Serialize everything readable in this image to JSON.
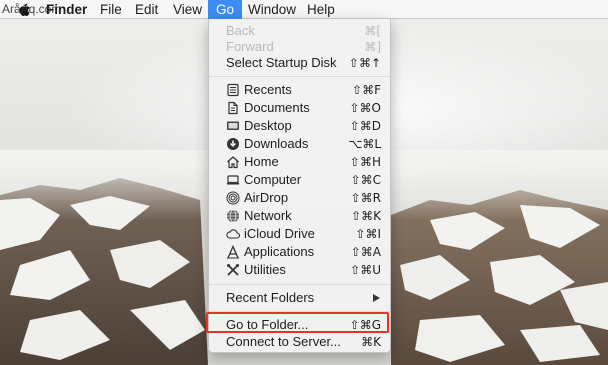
{
  "watermark": "AråAq.com",
  "menubar": {
    "app_name": "Finder",
    "items": [
      "File",
      "Edit",
      "View",
      "Go",
      "Window",
      "Help"
    ],
    "active_item": "Go",
    "active_color": "#3d8bf6"
  },
  "go_menu": {
    "nav": [
      {
        "label": "Back",
        "shortcut": "⌘[",
        "enabled": false
      },
      {
        "label": "Forward",
        "shortcut": "⌘]",
        "enabled": false
      },
      {
        "label": "Select Startup Disk",
        "shortcut": "⇧⌘↑",
        "enabled": true
      }
    ],
    "places": [
      {
        "label": "Recents",
        "shortcut": "⇧⌘F",
        "icon": "recents-icon"
      },
      {
        "label": "Documents",
        "shortcut": "⇧⌘O",
        "icon": "documents-icon"
      },
      {
        "label": "Desktop",
        "shortcut": "⇧⌘D",
        "icon": "desktop-icon"
      },
      {
        "label": "Downloads",
        "shortcut": "⌥⌘L",
        "icon": "downloads-icon"
      },
      {
        "label": "Home",
        "shortcut": "⇧⌘H",
        "icon": "home-icon"
      },
      {
        "label": "Computer",
        "shortcut": "⇧⌘C",
        "icon": "computer-icon"
      },
      {
        "label": "AirDrop",
        "shortcut": "⇧⌘R",
        "icon": "airdrop-icon"
      },
      {
        "label": "Network",
        "shortcut": "⇧⌘K",
        "icon": "network-icon"
      },
      {
        "label": "iCloud Drive",
        "shortcut": "⇧⌘I",
        "icon": "icloud-icon"
      },
      {
        "label": "Applications",
        "shortcut": "⇧⌘A",
        "icon": "applications-icon"
      },
      {
        "label": "Utilities",
        "shortcut": "⇧⌘U",
        "icon": "utilities-icon"
      }
    ],
    "recent_folders": {
      "label": "Recent Folders"
    },
    "go_to_folder": {
      "label": "Go to Folder...",
      "shortcut": "⇧⌘G"
    },
    "connect_to_server": {
      "label": "Connect to Server...",
      "shortcut": "⌘K"
    },
    "highlight_color": "#e53326"
  }
}
